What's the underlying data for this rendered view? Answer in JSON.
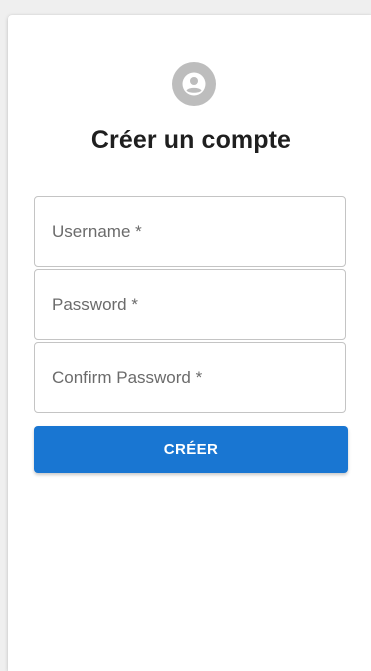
{
  "form": {
    "title": "Créer un compte",
    "avatar_icon": "account-circle-icon",
    "fields": [
      {
        "name": "username",
        "placeholder": "Username *",
        "value": ""
      },
      {
        "name": "password",
        "placeholder": "Password *",
        "value": ""
      },
      {
        "name": "confirm_password",
        "placeholder": "Confirm Password *",
        "value": ""
      }
    ],
    "submit_label": "CRÉER"
  },
  "colors": {
    "primary": "#1976d2",
    "avatar_bg": "#bdbdbd",
    "background": "#efefef",
    "card": "#ffffff"
  }
}
